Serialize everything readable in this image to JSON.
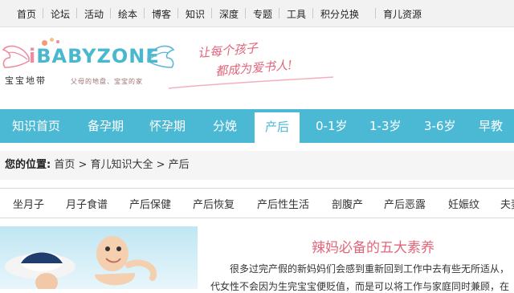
{
  "top_nav": [
    "首页",
    "论坛",
    "活动",
    "绘本",
    "博客",
    "知识",
    "深度",
    "专题",
    "工具",
    "积分兑换",
    "育儿资源"
  ],
  "logo": {
    "wordmark": "BABYZONE",
    "cn_name": "宝宝地带",
    "sub": "父母的地盘、宝宝的家",
    "slogan_line1": "让每个孩子",
    "slogan_line2": "都成为爱书人!"
  },
  "main_nav": [
    "知识首页",
    "备孕期",
    "怀孕期",
    "分娩",
    "产后",
    "0-1岁",
    "1-3岁",
    "3-6岁",
    "早教"
  ],
  "main_nav_active": "产后",
  "breadcrumb": {
    "label": "您的位置:",
    "path": "首页 > 育儿知识大全 > 产后"
  },
  "sub_tabs": [
    "坐月子",
    "月子食谱",
    "产后保健",
    "产后恢复",
    "产后性生活",
    "剖腹产",
    "产后恶露",
    "妊娠纹",
    "夫妻"
  ],
  "article": {
    "title": "辣妈必备的五大素养",
    "line1": "很多过完产假的新妈妈们会感到重新回到工作中去有些无所适从，",
    "line2": "代女性不会因为生完宝宝便贬值，而是可以将工作与家庭同时兼顾，在"
  },
  "colors": {
    "brand_blue": "#4bb9d4",
    "brand_pink": "#e2657a",
    "topbar_bg": "#f2f2f2"
  }
}
